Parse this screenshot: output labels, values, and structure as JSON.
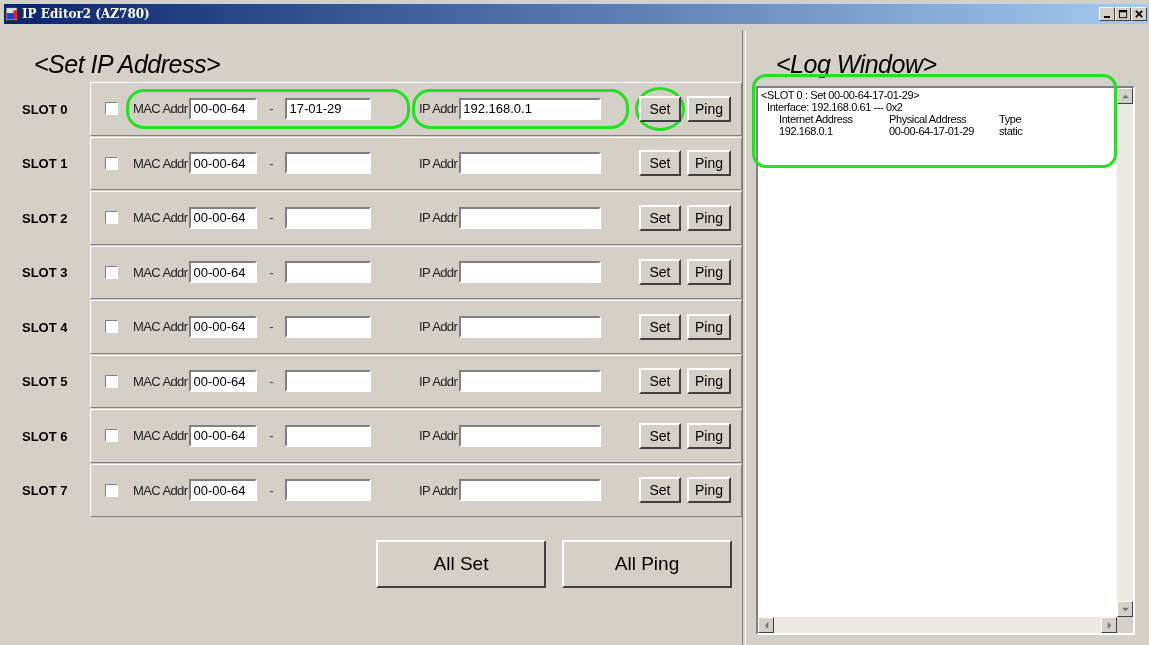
{
  "window": {
    "title": "IP Editor2 (AZ780)"
  },
  "set_panel": {
    "heading": "<Set IP Address>"
  },
  "slots": [
    {
      "label": "SLOT 0",
      "checked": false,
      "mac_label": "MAC Addr",
      "mac_prefix": "00-00-64",
      "separator": "-",
      "mac_suffix": "17-01-29",
      "ip_label": "IP Addr",
      "ip": "192.168.0.1",
      "set": "Set",
      "ping": "Ping",
      "highlighted": true
    },
    {
      "label": "SLOT 1",
      "checked": false,
      "mac_label": "MAC Addr",
      "mac_prefix": "00-00-64",
      "separator": "-",
      "ip_label": "IP Addr",
      "set": "Set",
      "ping": "Ping",
      "highlighted": false
    },
    {
      "label": "SLOT 2",
      "checked": false,
      "mac_label": "MAC Addr",
      "mac_prefix": "00-00-64",
      "separator": "-",
      "ip_label": "IP Addr",
      "set": "Set",
      "ping": "Ping",
      "highlighted": false
    },
    {
      "label": "SLOT 3",
      "checked": false,
      "mac_label": "MAC Addr",
      "mac_prefix": "00-00-64",
      "separator": "-",
      "ip_label": "IP Addr",
      "set": "Set",
      "ping": "Ping",
      "highlighted": false
    },
    {
      "label": "SLOT 4",
      "checked": false,
      "mac_label": "MAC Addr",
      "mac_prefix": "00-00-64",
      "separator": "-",
      "ip_label": "IP Addr",
      "set": "Set",
      "ping": "Ping",
      "highlighted": false
    },
    {
      "label": "SLOT 5",
      "checked": false,
      "mac_label": "MAC Addr",
      "mac_prefix": "00-00-64",
      "separator": "-",
      "ip_label": "IP Addr",
      "set": "Set",
      "ping": "Ping",
      "highlighted": false
    },
    {
      "label": "SLOT 6",
      "checked": false,
      "mac_label": "MAC Addr",
      "mac_prefix": "00-00-64",
      "separator": "-",
      "ip_label": "IP Addr",
      "set": "Set",
      "ping": "Ping",
      "highlighted": false
    },
    {
      "label": "SLOT 7",
      "checked": false,
      "mac_label": "MAC Addr",
      "mac_prefix": "00-00-64",
      "separator": "-",
      "ip_label": "IP Addr",
      "set": "Set",
      "ping": "Ping",
      "highlighted": false
    }
  ],
  "buttons": [
    "All Set",
    "All Ping"
  ],
  "log_panel": {
    "heading": "<Log Window>",
    "highlighted": true,
    "entry": {
      "title": "<SLOT 0 : Set 00-00-64-17-01-29>",
      "interface": "Interface: 192.168.0.61 --- 0x2",
      "columns": [
        "Internet Address",
        "Physical Address",
        "Type"
      ],
      "row": [
        "192.168.0.1",
        "00-00-64-17-01-29",
        "static"
      ]
    }
  }
}
